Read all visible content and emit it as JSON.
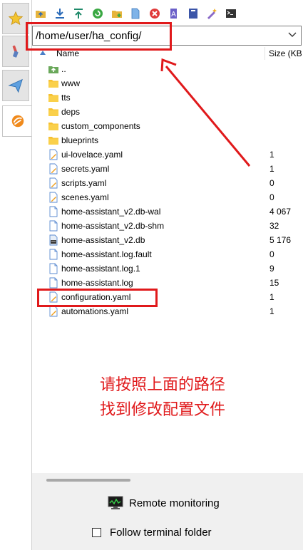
{
  "toolbar": {
    "icons": [
      "parent-folder-icon",
      "download-icon",
      "upload-icon",
      "refresh-icon",
      "new-folder-icon",
      "new-file-icon",
      "delete-icon",
      "rename-icon",
      "properties-icon",
      "bookmark-icon",
      "terminal-icon"
    ]
  },
  "path": {
    "value": "/home/user/ha_config/"
  },
  "columns": {
    "name": "Name",
    "size": "Size (KB"
  },
  "files": [
    {
      "name": "..",
      "size": "",
      "icon": "parent-folder-icon"
    },
    {
      "name": "www",
      "size": "",
      "icon": "folder-icon"
    },
    {
      "name": "tts",
      "size": "",
      "icon": "folder-icon"
    },
    {
      "name": "deps",
      "size": "",
      "icon": "folder-icon"
    },
    {
      "name": "custom_components",
      "size": "",
      "icon": "folder-icon"
    },
    {
      "name": "blueprints",
      "size": "",
      "icon": "folder-icon"
    },
    {
      "name": "ui-lovelace.yaml",
      "size": "1",
      "icon": "yaml-file-icon"
    },
    {
      "name": "secrets.yaml",
      "size": "1",
      "icon": "yaml-file-icon"
    },
    {
      "name": "scripts.yaml",
      "size": "0",
      "icon": "yaml-file-icon"
    },
    {
      "name": "scenes.yaml",
      "size": "0",
      "icon": "yaml-file-icon"
    },
    {
      "name": "home-assistant_v2.db-wal",
      "size": "4 067",
      "icon": "file-icon"
    },
    {
      "name": "home-assistant_v2.db-shm",
      "size": "32",
      "icon": "file-icon"
    },
    {
      "name": "home-assistant_v2.db",
      "size": "5 176",
      "icon": "db-file-icon"
    },
    {
      "name": "home-assistant.log.fault",
      "size": "0",
      "icon": "file-icon"
    },
    {
      "name": "home-assistant.log.1",
      "size": "9",
      "icon": "file-icon"
    },
    {
      "name": "home-assistant.log",
      "size": "15",
      "icon": "file-icon"
    },
    {
      "name": "configuration.yaml",
      "size": "1",
      "icon": "yaml-file-icon"
    },
    {
      "name": "automations.yaml",
      "size": "1",
      "icon": "yaml-file-icon"
    }
  ],
  "annotation": {
    "line1": "请按照上面的路径",
    "line2": "找到修改配置文件",
    "color": "#e0191b"
  },
  "bottom": {
    "remote_monitoring": "Remote monitoring",
    "follow_terminal": "Follow terminal folder"
  },
  "sidetabs": [
    "star-icon",
    "tools-icon",
    "send-icon",
    "sftp-icon"
  ]
}
